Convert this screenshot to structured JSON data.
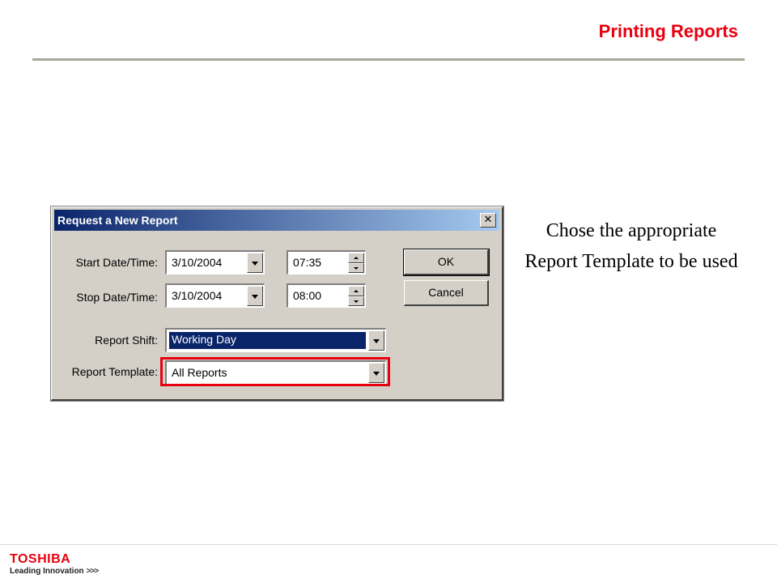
{
  "slide": {
    "title": "Printing Reports",
    "caption": "Chose the appropriate Report Template to be used"
  },
  "footer": {
    "brand": "TOSHIBA",
    "tagline": "Leading Innovation",
    "tagline_chevrons": ">>>"
  },
  "dialog": {
    "title": "Request a New Report",
    "close_glyph": "✕",
    "start": {
      "label": "Start Date/Time:",
      "date": "3/10/2004",
      "time": "07:35"
    },
    "stop": {
      "label": "Stop Date/Time:",
      "date": "3/10/2004",
      "time": "08:00"
    },
    "shift": {
      "label": "Report Shift:",
      "value": "Working Day"
    },
    "template": {
      "label": "Report Template:",
      "value": "All Reports"
    },
    "ok_label": "OK",
    "cancel_label": "Cancel"
  },
  "colors": {
    "accent_red": "#e8000f",
    "titlebar_start": "#0a246a",
    "titlebar_end": "#a6caf0",
    "dialog_face": "#d4d0c8"
  },
  "icons": {
    "close": "close-icon",
    "dropdown": "chevron-down-icon",
    "spin_up": "spin-up-icon",
    "spin_down": "spin-down-icon"
  }
}
